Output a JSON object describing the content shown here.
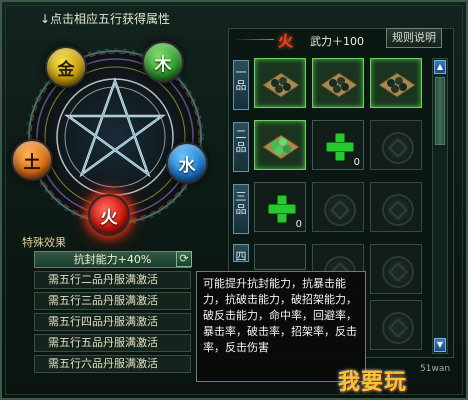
{
  "header": {
    "hint": "↓点击相应五行获得属性"
  },
  "elements": [
    {
      "name": "metal",
      "label": "金"
    },
    {
      "name": "wood",
      "label": "木"
    },
    {
      "name": "earth",
      "label": "土"
    },
    {
      "name": "water",
      "label": "水"
    },
    {
      "name": "fire",
      "label": "火"
    }
  ],
  "special_effects": {
    "title": "特殊效果",
    "active": "抗封能力+40%",
    "requirements": [
      "需五行二品丹服满激活",
      "需五行三品丹服满激活",
      "需五行四品丹服满激活",
      "需五行五品丹服满激活",
      "需五行六品丹服满激活"
    ]
  },
  "panel": {
    "element": "火",
    "stat": "武力＋100",
    "rules_button": "规则说明",
    "tiers": [
      {
        "label": [
          "一",
          "品"
        ],
        "slots": [
          {
            "state": "filled"
          },
          {
            "state": "filled"
          },
          {
            "state": "filled"
          }
        ]
      },
      {
        "label": [
          "二",
          "品"
        ],
        "slots": [
          {
            "state": "filled"
          },
          {
            "state": "add",
            "count": "0"
          },
          {
            "state": "locked"
          }
        ]
      },
      {
        "label": [
          "三",
          "品"
        ],
        "slots": [
          {
            "state": "add",
            "count": "0"
          },
          {
            "state": "locked"
          },
          {
            "state": "locked"
          }
        ]
      },
      {
        "label": [
          "四",
          ""
        ],
        "slots": [
          {
            "state": "add"
          },
          {
            "state": "locked"
          },
          {
            "state": "locked"
          }
        ]
      }
    ]
  },
  "tooltip": {
    "text": "可能提升抗封能力，抗暴击能力，抗破击能力，破招架能力，破反击能力，命中率，回避率，暴击率，破击率，招架率，反击率，反击伤害"
  },
  "watermark": {
    "text": "我要玩",
    "sub": "51wan"
  },
  "colors": {
    "fire": "#ff3a22",
    "accent_green": "#28c830",
    "border": "#3b5a48"
  }
}
